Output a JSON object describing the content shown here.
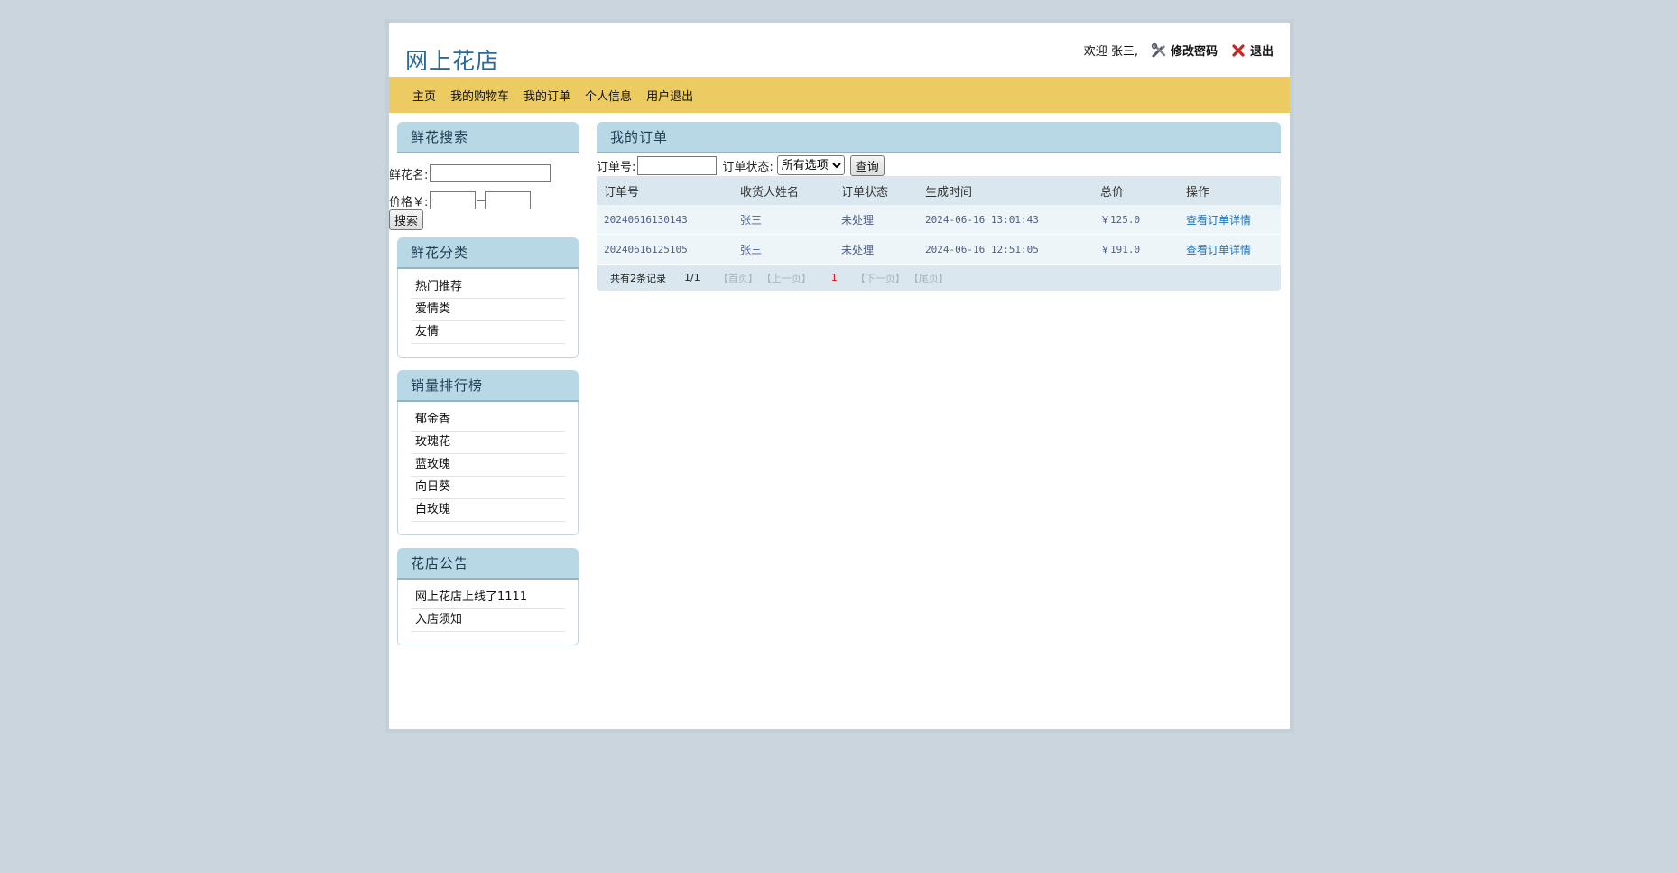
{
  "header": {
    "logo": "网上花店",
    "welcome": "欢迎 张三,",
    "change_password": "修改密码",
    "logout": "退出"
  },
  "nav": {
    "items": [
      {
        "label": "主页"
      },
      {
        "label": "我的购物车"
      },
      {
        "label": "我的订单"
      },
      {
        "label": "个人信息"
      },
      {
        "label": "用户退出"
      }
    ]
  },
  "search": {
    "title": "鲜花搜索",
    "name_label": "鲜花名:",
    "name_value": "",
    "price_label": "价格￥:",
    "price_min": "",
    "price_max": "",
    "dash": "—",
    "button": "搜索"
  },
  "categories": {
    "title": "鲜花分类",
    "items": [
      "热门推荐",
      "爱情类",
      "友情"
    ]
  },
  "ranking": {
    "title": "销量排行榜",
    "items": [
      "郁金香",
      "玫瑰花",
      "蓝玫瑰",
      "向日葵",
      "白玫瑰"
    ]
  },
  "notice": {
    "title": "花店公告",
    "items": [
      "网上花店上线了1111",
      "入店须知"
    ]
  },
  "orders": {
    "title": "我的订单",
    "filter": {
      "order_no_label": "订单号:",
      "order_no_value": "",
      "status_label": "订单状态:",
      "status_selected": "所有选项",
      "query_button": "查询"
    },
    "columns": [
      "订单号",
      "收货人姓名",
      "订单状态",
      "生成时间",
      "总价",
      "操作"
    ],
    "rows": [
      {
        "order_no": "20240616130143",
        "receiver": "张三",
        "status": "未处理",
        "time": "2024-06-16 13:01:43",
        "total": "￥125.0",
        "action": "查看订单详情"
      },
      {
        "order_no": "20240616125105",
        "receiver": "张三",
        "status": "未处理",
        "time": "2024-06-16 12:51:05",
        "total": "￥191.0",
        "action": "查看订单详情"
      }
    ],
    "pager": {
      "total": "共有2条记录",
      "page": "1/1",
      "first": "【首页】",
      "prev": "【上一页】",
      "current": "1",
      "next": "【下一页】",
      "last": "【尾页】"
    }
  },
  "colors": {
    "navbar": "#eccb63",
    "box_head": "#b9d8e5",
    "link": "#1b72b8",
    "background": "#cbd5dd"
  }
}
